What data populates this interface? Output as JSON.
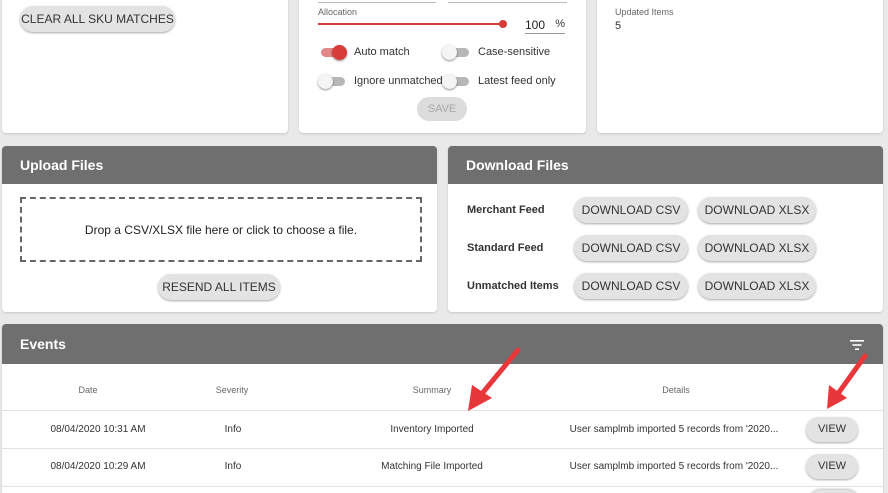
{
  "sku_card": {
    "clear_button": "CLEAR ALL SKU MATCHES"
  },
  "allocation": {
    "label": "Allocation",
    "value": "100",
    "unit": "%",
    "slider_fraction": 1.0,
    "toggles": [
      {
        "label": "Auto match",
        "on": true
      },
      {
        "label": "Case-sensitive",
        "on": false
      },
      {
        "label": "Ignore unmatched",
        "on": false
      },
      {
        "label": "Latest feed only",
        "on": false
      }
    ],
    "save_button": "SAVE"
  },
  "stats": {
    "updated_label": "Updated Items",
    "updated_value": "5"
  },
  "upload": {
    "title": "Upload Files",
    "drop_text": "Drop a CSV/XLSX file here or click to choose a file.",
    "resend_button": "RESEND ALL ITEMS"
  },
  "download": {
    "title": "Download Files",
    "rows": [
      {
        "label": "Merchant Feed",
        "csv": "DOWNLOAD CSV",
        "xlsx": "DOWNLOAD XLSX"
      },
      {
        "label": "Standard Feed",
        "csv": "DOWNLOAD CSV",
        "xlsx": "DOWNLOAD XLSX"
      },
      {
        "label": "Unmatched Items",
        "csv": "DOWNLOAD CSV",
        "xlsx": "DOWNLOAD XLSX"
      }
    ]
  },
  "events": {
    "title": "Events",
    "columns": [
      "Date",
      "Severity",
      "Summary",
      "Details"
    ],
    "rows": [
      {
        "date": "08/04/2020 10:31 AM",
        "severity": "Info",
        "summary": "Inventory Imported",
        "details": "User samplmb imported 5 records from '2020...",
        "action": "VIEW"
      },
      {
        "date": "08/04/2020 10:29 AM",
        "severity": "Info",
        "summary": "Matching File Imported",
        "details": "User samplmb imported 5 records from '2020...",
        "action": "VIEW"
      }
    ]
  },
  "colors": {
    "accent": "#d93a3a",
    "header": "#6f6f6f",
    "background": "#e9e9e9",
    "arrow": "#e8373a"
  },
  "icons": [
    "filter-icon",
    "annotation-arrow"
  ]
}
